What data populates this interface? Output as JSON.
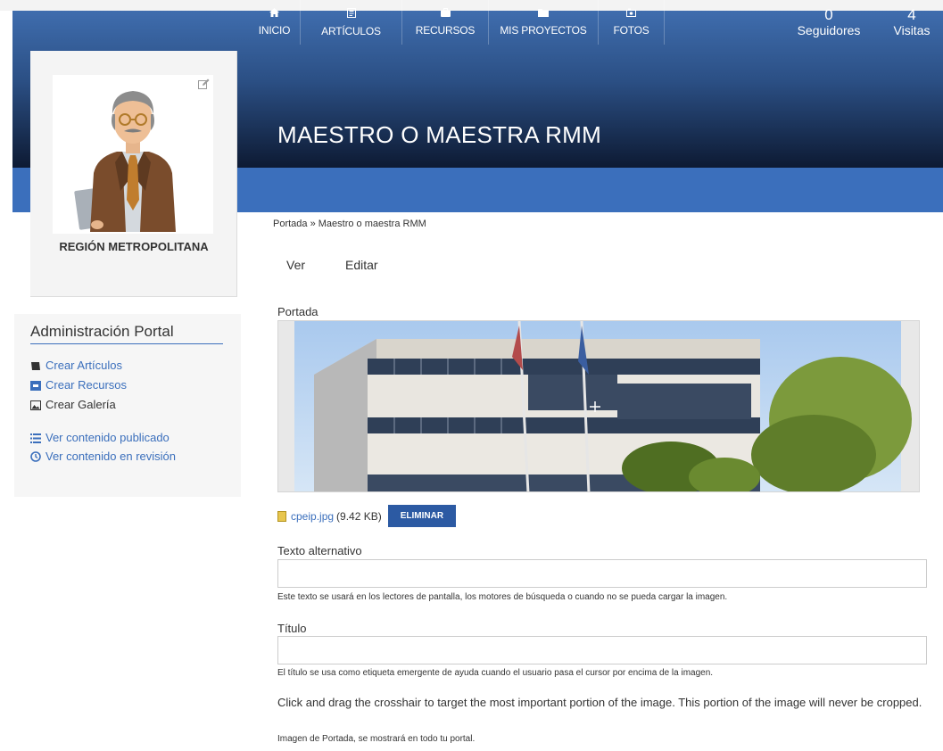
{
  "header": {
    "title": "MAESTRO O MAESTRA RMM"
  },
  "nav": {
    "items": [
      {
        "label": "INICIO",
        "icon": "home-icon"
      },
      {
        "label": "ARTÍCULOS",
        "icon": "article-icon"
      },
      {
        "label": "RECURSOS",
        "icon": "briefcase-icon"
      },
      {
        "label": "MIS PROYECTOS",
        "icon": "folder-icon"
      },
      {
        "label": "FOTOS",
        "icon": "photo-icon"
      }
    ],
    "followers": {
      "count": "0",
      "label": "Seguidores"
    },
    "visits": {
      "count": "4",
      "label": "Visitas"
    }
  },
  "profile": {
    "region": "REGIÓN METROPOLITANA",
    "edit_icon": "edit-icon"
  },
  "admin": {
    "title": "Administración Portal",
    "create_links": [
      {
        "label": "Crear Artículos",
        "icon": "book-icon"
      },
      {
        "label": "Crear Recursos",
        "icon": "resource-icon"
      },
      {
        "label": "Crear Galería",
        "icon": "gallery-icon"
      }
    ],
    "view_links": [
      {
        "label": "Ver contenido publicado",
        "icon": "list-icon"
      },
      {
        "label": "Ver contenido en revisión",
        "icon": "clock-icon"
      }
    ]
  },
  "breadcrumb": "Portada » Maestro o maestra RMM",
  "tabs": [
    {
      "label": "Ver"
    },
    {
      "label": "Editar"
    }
  ],
  "form": {
    "portada_label": "Portada",
    "file_name": "cpeip.jpg",
    "file_size": "(9.42 KB)",
    "remove_label": "ELIMINAR",
    "alt_label": "Texto alternativo",
    "alt_value": "",
    "alt_help": "Este texto se usará en los lectores de pantalla, los motores de búsqueda o cuando no se pueda cargar la imagen.",
    "title_label": "Título",
    "title_value": "",
    "title_help": "El título se usa como etiqueta emergente de ayuda cuando el usuario pasa el cursor por encima de la imagen.",
    "crop_note": "Click and drag the crosshair to target the most important portion of the image. This portion of the image will never be cropped.",
    "cover_note": "Imagen de Portada, se mostrará en todo tu portal."
  },
  "colors": {
    "nav_blue": "#3b6fbc",
    "header_dark": "#0d1a33",
    "button_blue": "#2c5aa3"
  }
}
